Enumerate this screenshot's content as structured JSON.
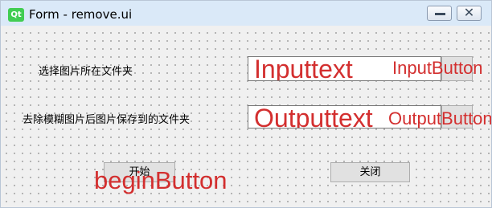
{
  "window": {
    "title": "Form - remove.ui",
    "logo_text": "Qt",
    "minimize_icon": "minimize-icon",
    "close_icon": "close-icon",
    "close_glyph": "✕"
  },
  "form": {
    "input_label": "选择图片所在文件夹",
    "input_placeholder": "Inputtext",
    "input_button_name": "InputButton",
    "output_label": "去除模糊图片后图片保存到的文件夹",
    "output_placeholder": "Outputtext",
    "output_button_name": "OutputButton",
    "begin_label": "开始",
    "begin_button_name": "beginButton",
    "close_label": "关闭"
  },
  "colors": {
    "object_name_overlay": "#d32f2f",
    "titlebar": "#dae9f8",
    "qt_logo": "#41cd52",
    "designer_grid_dots": "#8c8c8c"
  }
}
